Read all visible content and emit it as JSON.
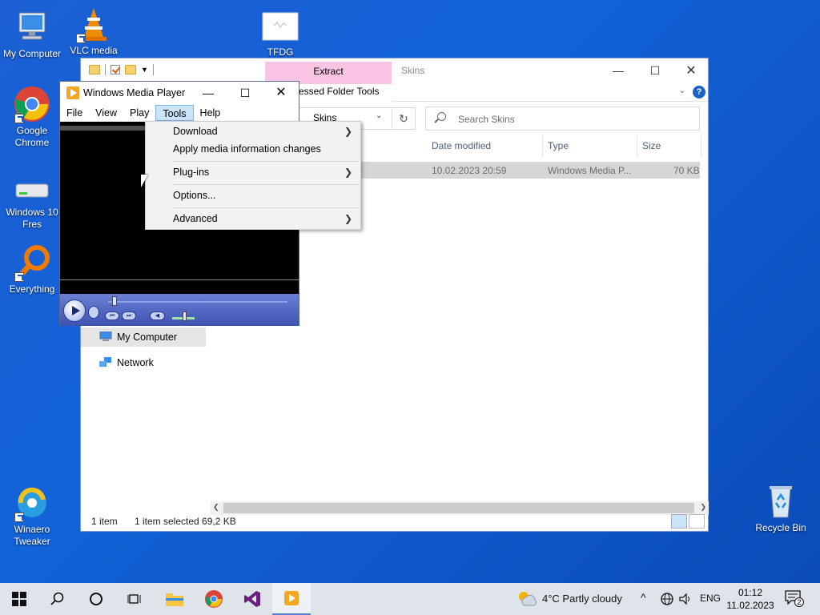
{
  "desktop": {
    "icons": [
      {
        "label": "My Computer"
      },
      {
        "label": "VLC media"
      },
      {
        "label": "TFDG"
      },
      {
        "label": "Google Chrome"
      },
      {
        "label": "Windows 10 Fres"
      },
      {
        "label": "Everything"
      },
      {
        "label": "Winaero Tweaker"
      },
      {
        "label": "Recycle Bin"
      }
    ]
  },
  "explorer": {
    "title": "Skins",
    "extract_tab": "Extract",
    "compressed_tab": "ressed Folder Tools",
    "address": "Skins",
    "search_placeholder": "Search Skins",
    "columns": [
      "Date modified",
      "Type",
      "Size"
    ],
    "row": {
      "date": "10.02.2023 20:59",
      "type": "Windows Media P...",
      "size": "70 KB"
    },
    "nav": [
      {
        "label": "My Computer"
      },
      {
        "label": "Network"
      }
    ],
    "status": {
      "count": "1 item",
      "selected": "1 item selected  69,2 KB"
    }
  },
  "wmp": {
    "title": "Windows Media Player",
    "menu": [
      "File",
      "View",
      "Play",
      "Tools",
      "Help"
    ],
    "tools_menu": [
      {
        "label": "Download",
        "submenu": true
      },
      {
        "label": "Apply media information changes",
        "submenu": false
      },
      {
        "label": "Plug-ins",
        "submenu": true
      },
      {
        "label": "Options...",
        "submenu": false
      },
      {
        "label": "Advanced",
        "submenu": true
      }
    ]
  },
  "taskbar": {
    "weather": "4°C  Partly cloudy",
    "lang": "ENG",
    "time": "01:12",
    "date": "11.02.2023",
    "notifications": "2"
  },
  "colors": {
    "accent": "#0f56c8",
    "extract_tab": "#f9c4e4",
    "selection": "#cce4f7"
  }
}
